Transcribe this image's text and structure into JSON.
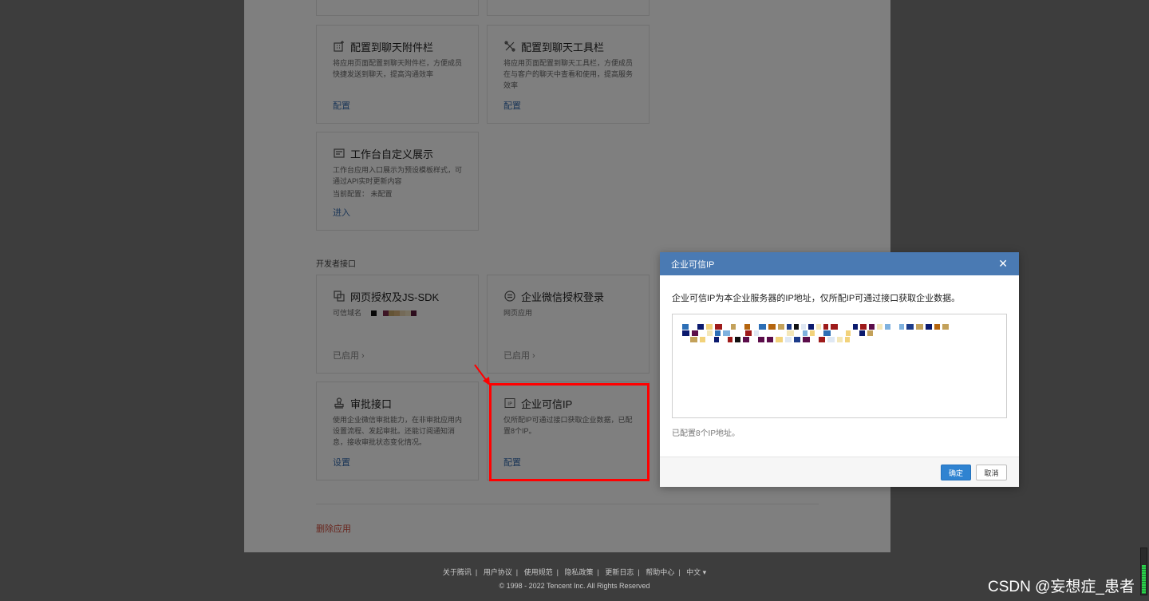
{
  "cards": {
    "attach": {
      "title": "配置到聊天附件栏",
      "desc": "将应用页面配置到聊天附件栏，方便成员快捷发送到聊天，提高沟通效率",
      "link": "配置"
    },
    "toolbar": {
      "title": "配置到聊天工具栏",
      "desc": "将应用页面配置到聊天工具栏，方便成员在与客户的聊天中查看和使用，提高服务效率",
      "link": "配置"
    },
    "workbench": {
      "title": "工作台自定义展示",
      "desc": "工作台应用入口展示为预设模板样式，可通过API实时更新内容",
      "current": "当前配置： 未配置",
      "link": "进入"
    },
    "webauth": {
      "title": "网页授权及JS-SDK",
      "desc": "可信域名",
      "status": "已启用"
    },
    "wxlogin": {
      "title": "企业微信授权登录",
      "desc": "网页应用",
      "status": "已启用"
    },
    "approval": {
      "title": "审批接口",
      "desc": "使用企业微信审批能力，在非审批应用内设置流程、发起审批。还能订阅通知消息，接收审批状态变化情况。",
      "link": "设置"
    },
    "trustedip": {
      "title": "企业可信IP",
      "desc": "仅所配IP可通过接口获取企业数据，已配置8个IP。",
      "link": "配置"
    }
  },
  "section": {
    "dev_api": "开发者接口"
  },
  "delete_app": "删除应用",
  "dialog": {
    "title": "企业可信IP",
    "close": "✕",
    "desc": "企业可信IP为本企业服务器的IP地址，仅所配IP可通过接口获取企业数据。",
    "count": "已配置8个IP地址。",
    "ok": "确定",
    "cancel": "取消"
  },
  "footer": {
    "links": [
      "关于腾讯",
      "用户协议",
      "使用规范",
      "隐私政策",
      "更新日志",
      "帮助中心",
      "中文 ▾"
    ],
    "copyright": "© 1998 - 2022 Tencent Inc. All Rights Reserved"
  },
  "watermark": "CSDN @妄想症_患者",
  "colors": {
    "accent": "#4a7ab3",
    "link": "#3a6fb0",
    "danger": "#d14b3b",
    "highlight": "#ff0000"
  }
}
